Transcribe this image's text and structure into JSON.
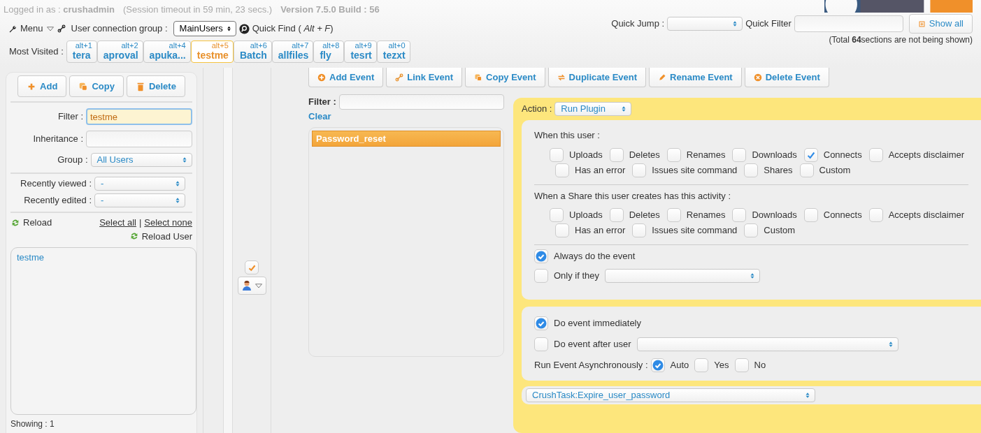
{
  "session": {
    "label": "Logged in as :",
    "user": "crushadmin",
    "timeout": "(Session timeout in 59 min, 23 secs.)",
    "version": "Version 7.5.0 Build : 56"
  },
  "toolbar": {
    "menu": "Menu",
    "group_label": "User connection group :",
    "group": "MainUsers",
    "quick_find": "Quick Find ( *Alt + F*)",
    "quick_jump_label": "Quick Jump :",
    "quick_filter_label": "Quick Filter",
    "show_all": "Show all",
    "total_note": "(Total **64**sections are not being shown)"
  },
  "most_visited": {
    "label": "Most Visited :",
    "tabs": [
      {
        "shortcut": "alt+1",
        "label": "tera",
        "selected": false
      },
      {
        "shortcut": "alt+2",
        "label": "aproval",
        "selected": false
      },
      {
        "shortcut": "alt+4",
        "label": "apuka...",
        "selected": false
      },
      {
        "shortcut": "alt+5",
        "label": "testme",
        "selected": true
      },
      {
        "shortcut": "alt+6",
        "label": "Batch",
        "selected": false
      },
      {
        "shortcut": "alt+7",
        "label": "allfiles",
        "selected": false
      },
      {
        "shortcut": "alt+8",
        "label": "fly",
        "selected": false
      },
      {
        "shortcut": "alt+9",
        "label": "tesrt",
        "selected": false
      },
      {
        "shortcut": "alt+0",
        "label": "tezxt",
        "selected": false
      }
    ]
  },
  "user_panel": {
    "buttons": [
      {
        "kind": "add",
        "label": "Add"
      },
      {
        "kind": "copy",
        "label": "Copy"
      },
      {
        "kind": "delete",
        "label": "Delete"
      }
    ],
    "filter_label": "Filter :",
    "filter": "testme",
    "inheritance_label": "Inheritance :",
    "group_label": "Group :",
    "group": "All Users",
    "viewed_label": "Recently viewed :",
    "viewed": "-",
    "edited_label": "Recently edited :",
    "edited": "-",
    "reload": "Reload",
    "select_all": "Select all",
    "separator": "|",
    "select_none": "Select none",
    "reload_user": "Reload User",
    "users": [
      "testme"
    ],
    "showing": "Showing : 1"
  },
  "event_toolbar": [
    {
      "kind": "add",
      "label": "Add Event"
    },
    {
      "kind": "link",
      "label": "Link Event"
    },
    {
      "kind": "copy",
      "label": "Copy Event"
    },
    {
      "kind": "duplicate",
      "label": "Duplicate Event"
    },
    {
      "kind": "rename",
      "label": "Rename Event"
    },
    {
      "kind": "delete",
      "label": "Delete Event"
    }
  ],
  "event_list": {
    "filter_label": "Filter :",
    "clear": "Clear",
    "events": [
      {
        "name": "Password_reset",
        "selected": true
      }
    ]
  },
  "action": {
    "label": "Action :",
    "value": "Run Plugin",
    "user_title": "When this user :",
    "user_rows": [
      {
        "items": [
          {
            "label": "Uploads",
            "checked": false
          },
          {
            "label": "Deletes",
            "checked": false
          },
          {
            "label": "Renames",
            "checked": false
          },
          {
            "label": "Downloads",
            "checked": false
          },
          {
            "label": "Connects",
            "checked": true
          },
          {
            "label": "Accepts disclaimer",
            "checked": false
          }
        ]
      },
      {
        "items": [
          {
            "label": "Has an error",
            "checked": false
          },
          {
            "label": "Issues site command",
            "checked": false
          },
          {
            "label": "Shares",
            "checked": false
          },
          {
            "label": "Custom",
            "checked": false
          }
        ]
      }
    ],
    "share_title": "When a Share this user creates has this activity :",
    "share_rows": [
      {
        "items": [
          {
            "label": "Uploads",
            "checked": false
          },
          {
            "label": "Deletes",
            "checked": false
          },
          {
            "label": "Renames",
            "checked": false
          },
          {
            "label": "Downloads",
            "checked": false
          },
          {
            "label": "Connects",
            "checked": false
          },
          {
            "label": "Accepts disclaimer",
            "checked": false
          }
        ]
      },
      {
        "items": [
          {
            "label": "Has an error",
            "checked": false
          },
          {
            "label": "Issues site command",
            "checked": false
          },
          {
            "label": "Custom",
            "checked": false
          }
        ]
      }
    ],
    "always": {
      "label": "Always do the event",
      "checked": true
    },
    "only_if": {
      "label": "Only if they",
      "checked": false
    },
    "immediately": {
      "label": "Do event immediately",
      "checked": true
    },
    "after_user": {
      "label": "Do event after user",
      "checked": false
    },
    "async_label": "Run Event Asynchronously :",
    "async_options": [
      {
        "label": "Auto",
        "checked": true
      },
      {
        "label": "Yes",
        "checked": false
      },
      {
        "label": "No",
        "checked": false
      }
    ],
    "task": "CrushTask:Expire_user_password"
  }
}
